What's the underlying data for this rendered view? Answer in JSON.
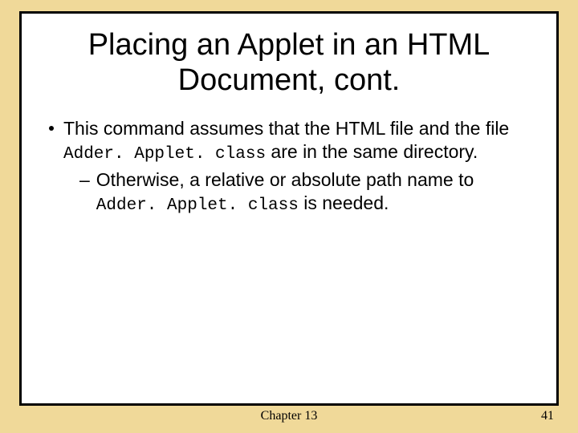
{
  "slide": {
    "title": "Placing an Applet in an HTML Document, cont.",
    "bullet": {
      "text_before_code": "This command assumes that the HTML file and the file ",
      "code1": "Adder. Applet. class",
      "text_after_code": " are in the same directory."
    },
    "sub": {
      "dash": "–",
      "text_before_code": "Otherwise, a relative or absolute path name to ",
      "code2": "Adder. Applet. class",
      "text_after_code": " is needed."
    }
  },
  "footer": {
    "center": "Chapter 13",
    "page": "41"
  }
}
